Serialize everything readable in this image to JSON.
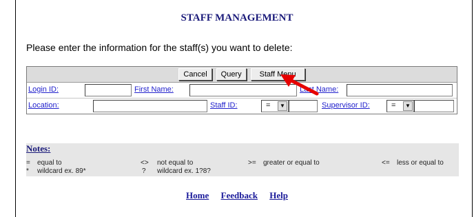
{
  "page": {
    "title": "STAFF MANAGEMENT",
    "prompt": "Please enter the information for the staff(s) you want to delete:"
  },
  "toolbar": {
    "cancel_label": "Cancel",
    "query_label": "Query",
    "staff_menu_label": "Staff Menu"
  },
  "form": {
    "login_id_label": "Login ID:",
    "login_id_value": "",
    "first_name_label": "First Name:",
    "first_name_value": "",
    "last_name_label": "Last Name:",
    "last_name_value": "",
    "location_label": "Location:",
    "location_value": "",
    "staff_id_label": "Staff ID:",
    "staff_id_operator": "=",
    "staff_id_value": "",
    "supervisor_id_label": "Supervisor ID:",
    "supervisor_id_operator": "=",
    "supervisor_id_value": ""
  },
  "notes": {
    "title": "Notes:",
    "items": [
      {
        "symbol": "=",
        "text": "equal to"
      },
      {
        "symbol": "<>",
        "text": "not equal to"
      },
      {
        "symbol": ">=",
        "text": "greater or equal to"
      },
      {
        "symbol": "<=",
        "text": "less or equal to"
      },
      {
        "symbol": "*",
        "text": "wildcard ex. 89*"
      },
      {
        "symbol": "?",
        "text": "wildcard ex. 1?8?"
      }
    ]
  },
  "footer": {
    "home": "Home",
    "feedback": "Feedback",
    "help": "Help"
  },
  "colors": {
    "title": "#1a1a7a",
    "field_label": "#2020cc",
    "pointer_arrow": "#e60000"
  }
}
